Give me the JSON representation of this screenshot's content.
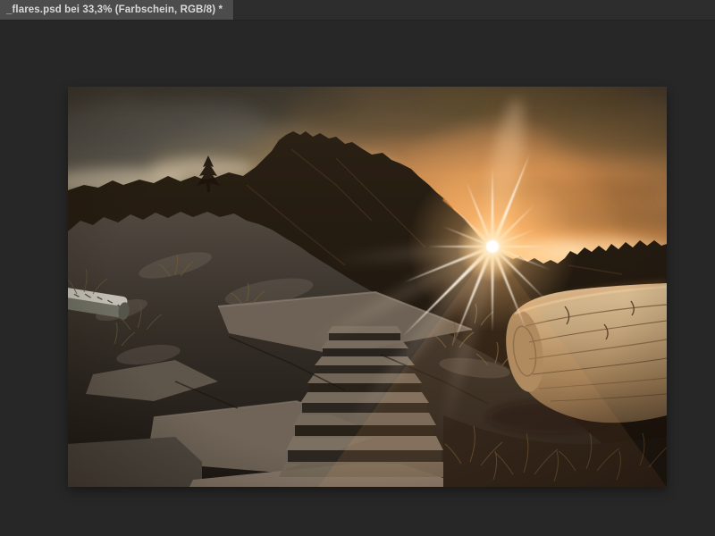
{
  "tab_bar": {
    "tabs": [
      {
        "title": "_flares.psd bei 33,3% (Farbschein, RGB/8) *",
        "active": true
      }
    ]
  },
  "canvas": {
    "image_description": "Sonnenuntergang mit Sonnenstern über felsigem Bergpfad mit Steintreppe und liegendem Baumstamm"
  },
  "colors": {
    "app_background": "#272727",
    "tab_bar_background": "#2d2d2d",
    "active_tab_background": "#4c4c4c",
    "tab_text": "#d9d9d9"
  }
}
